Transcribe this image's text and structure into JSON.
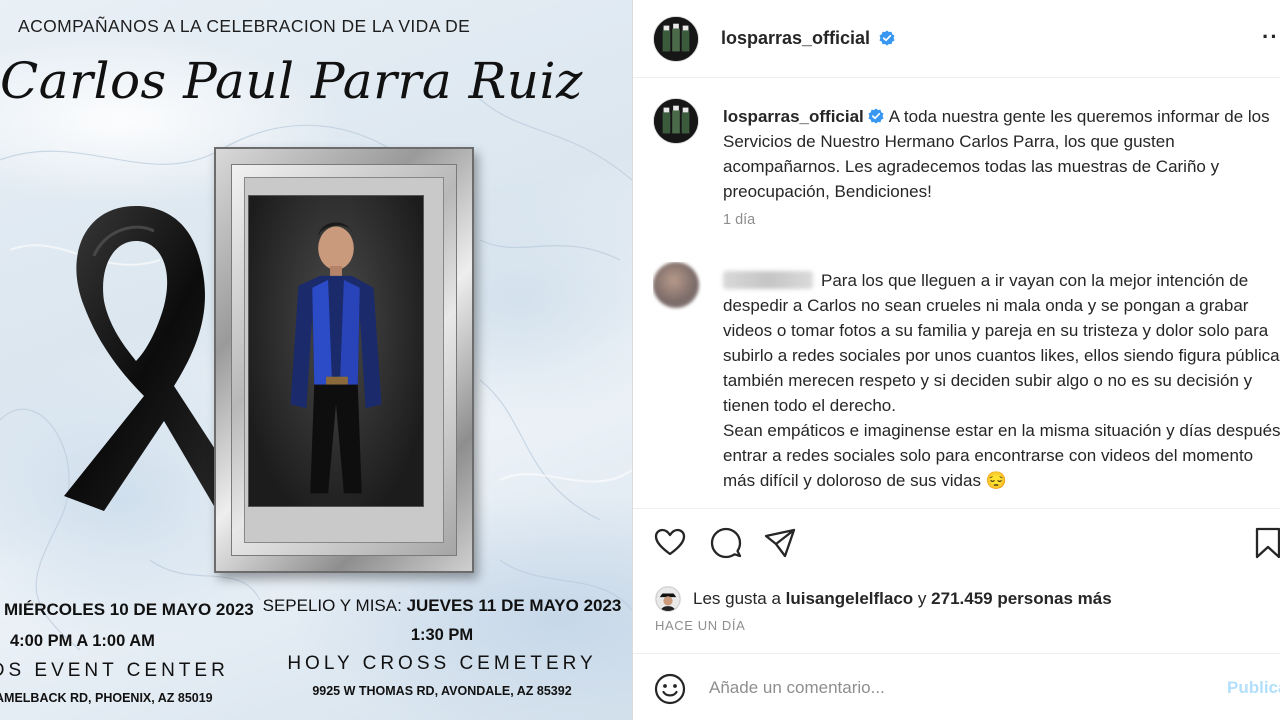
{
  "flyer": {
    "header": "ACOMPAÑANOS A LA CELEBRACION DE LA VIDA DE",
    "name": "Carlos Paul Parra Ruiz",
    "event_left": {
      "date": "MIÉRCOLES 10 DE MAYO 2023",
      "time": "4:00 PM A 1:00 AM",
      "venue": "NDS EVENT CENTER",
      "address": "AMELBACK RD, PHOENIX, AZ 85019"
    },
    "event_right": {
      "label": "SEPELIO Y MISA:",
      "date": "JUEVES 11 DE MAYO 2023",
      "time": "1:30 PM",
      "venue": "HOLY CROSS CEMETERY",
      "address": "9925 W THOMAS RD, AVONDALE, AZ 85392"
    }
  },
  "post": {
    "header": {
      "username": "losparras_official",
      "verified_icon": "verified-badge-icon",
      "more_icon": "more-options-icon"
    },
    "caption": {
      "username": "losparras_official",
      "text": "A toda nuestra gente les queremos informar de los Servicios de Nuestro Hermano Carlos Parra, los que gusten acompañarnos. Les agradecemos todas las muestras de Cariño y preocupación, Bendiciones!",
      "time": "1 día"
    },
    "comment": {
      "text": "Para los que lleguen a ir vayan con la mejor intención de despedir a Carlos no sean crueles ni mala onda y se pongan a grabar videos o tomar fotos a su familia y pareja en su tristeza y dolor solo para subirlo a redes sociales por unos cuantos likes, ellos siendo figura pública también merecen respeto y si deciden subir algo o no es su decisión y tienen todo el derecho.",
      "text2": "Sean empáticos e imaginense estar en la misma situación y días después entrar a redes sociales solo para encontrarse con videos del momento más difícil y doloroso de sus vidas 😔"
    },
    "actions": {
      "like_icon": "heart-icon",
      "comment_icon": "comment-icon",
      "share_icon": "share-icon",
      "save_icon": "bookmark-icon"
    },
    "likes": {
      "prefix": "Les gusta a",
      "user": "luisangelelflaco",
      "middle": "y",
      "count_text": "271.459 personas más"
    },
    "timestamp": "HACE UN DÍA",
    "add_comment": {
      "placeholder": "Añade un comentario...",
      "publish_label": "Publicar"
    }
  },
  "colors": {
    "verified": "#3897f0",
    "publish_disabled": "#b2dffc",
    "secondary_text": "#8e8e8e"
  }
}
